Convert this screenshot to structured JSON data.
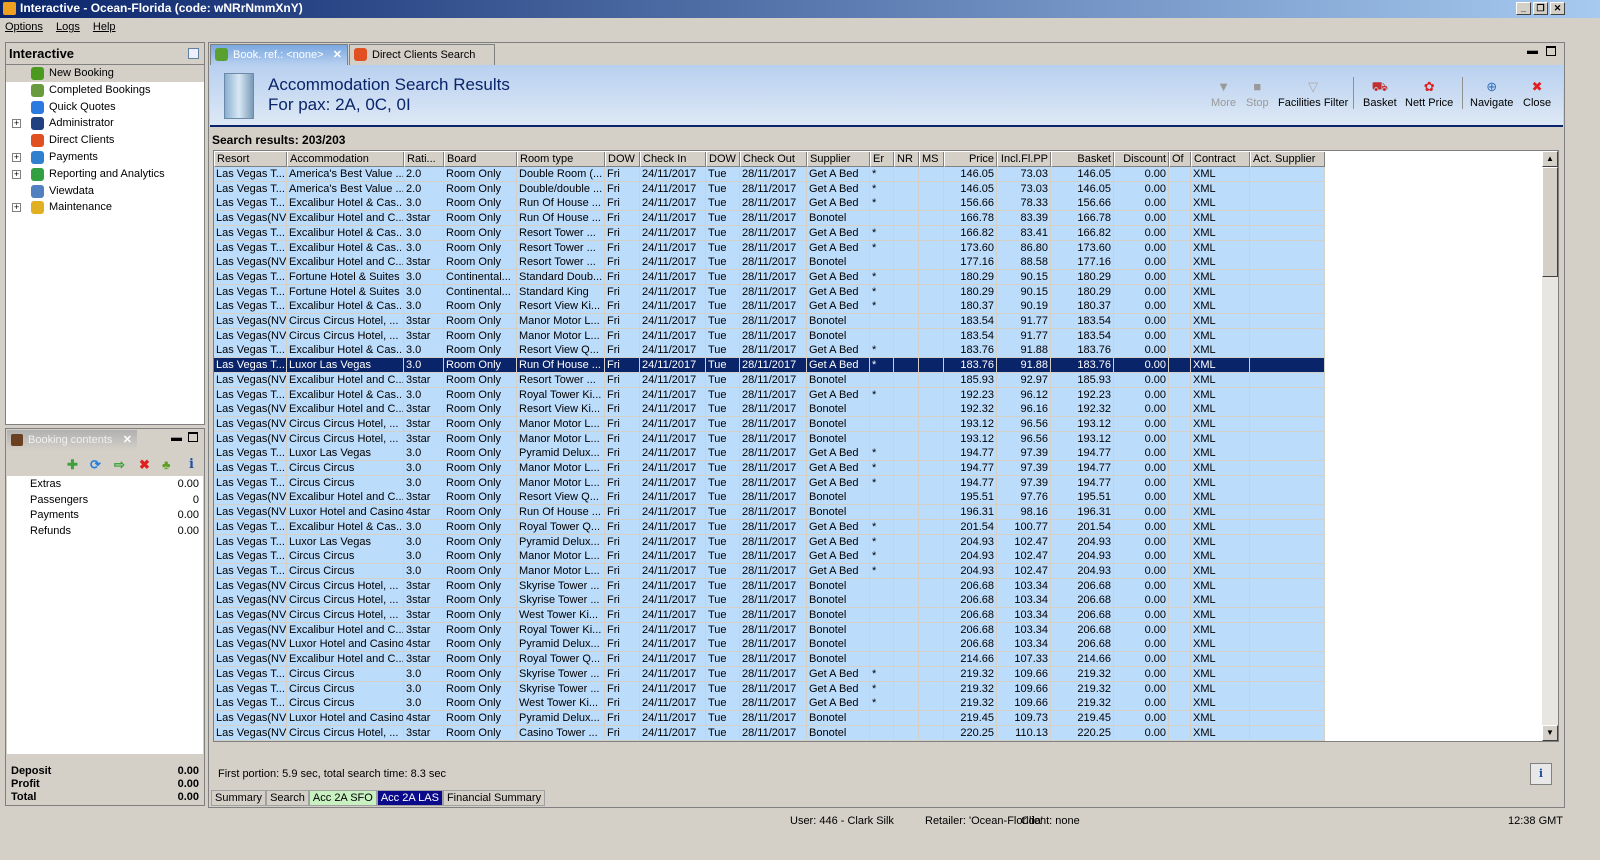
{
  "window": {
    "title": "Interactive - Ocean-Florida (code: wNRrNmmXnY)",
    "min": "_",
    "max": "❐",
    "close": "✕"
  },
  "menu": [
    "Options",
    "Logs",
    "Help"
  ],
  "nav": {
    "title": "Interactive",
    "items": [
      {
        "label": "New Booking",
        "expand": false,
        "color": "#4a9a20"
      },
      {
        "label": "Completed Bookings",
        "expand": false,
        "color": "#6a9a40"
      },
      {
        "label": "Quick Quotes",
        "expand": false,
        "color": "#2a7ae0"
      },
      {
        "label": "Administrator",
        "expand": true,
        "color": "#204080"
      },
      {
        "label": "Direct Clients",
        "expand": false,
        "color": "#e05020"
      },
      {
        "label": "Payments",
        "expand": true,
        "color": "#3080d0"
      },
      {
        "label": "Reporting and Analytics",
        "expand": true,
        "color": "#30a040"
      },
      {
        "label": "Viewdata",
        "expand": false,
        "color": "#5080c0"
      },
      {
        "label": "Maintenance",
        "expand": true,
        "color": "#e0b020"
      }
    ]
  },
  "booking": {
    "tab": "Booking contents",
    "close": "✕",
    "tools": {
      "add": "✚",
      "refresh": "⟳",
      "basket": "⇨",
      "delete": "✖",
      "palm": "♣",
      "info": "i"
    },
    "rows": [
      {
        "label": "Extras",
        "value": "0.00"
      },
      {
        "label": "Passengers",
        "value": "0"
      },
      {
        "label": "Payments",
        "value": "0.00"
      },
      {
        "label": "Refunds",
        "value": "0.00"
      }
    ],
    "totals": [
      {
        "label": "Deposit",
        "value": "0.00"
      },
      {
        "label": "Profit",
        "value": "0.00"
      },
      {
        "label": "Total",
        "value": "0.00"
      }
    ]
  },
  "tabs": [
    {
      "label": "Book. ref.: <none>",
      "close": "✕"
    },
    {
      "label": "Direct Clients Search"
    }
  ],
  "header": {
    "title": "Accommodation Search Results",
    "subtitle": "For pax: 2A, 0C, 0I"
  },
  "toolbar": {
    "more": "More",
    "stop": "Stop",
    "facilities": "Facilities Filter",
    "basket": "Basket",
    "nett": "Nett Price",
    "navigate": "Navigate",
    "close": "Close"
  },
  "results_label": "Search results: 203/203",
  "columns": [
    "Resort",
    "Accommodation",
    "Rati...",
    "Board",
    "Room type",
    "DOW",
    "Check In",
    "DOW",
    "Check Out",
    "Supplier",
    "Er",
    "NR",
    "MS",
    "Price",
    "Incl.Fl.PP",
    "Basket",
    "Discount",
    "Of",
    "Contract",
    "Act. Supplier"
  ],
  "defaults": {
    "dow_in": "Fri",
    "check_in": "24/11/2017",
    "dow_out": "Tue",
    "check_out": "28/11/2017",
    "discount": "0.00",
    "contract": "XML"
  },
  "selected_row": 13,
  "rows": [
    [
      "Las Vegas T...",
      "America's Best Value ...",
      "2.0",
      "Room Only",
      "Double Room (...",
      "Get A Bed",
      "*",
      "146.05",
      "73.03",
      "146.05"
    ],
    [
      "Las Vegas T...",
      "America's Best Value ...",
      "2.0",
      "Room Only",
      "Double/double ...",
      "Get A Bed",
      "*",
      "146.05",
      "73.03",
      "146.05"
    ],
    [
      "Las Vegas T...",
      "Excalibur Hotel & Cas...",
      "3.0",
      "Room Only",
      "Run Of House ...",
      "Get A Bed",
      "*",
      "156.66",
      "78.33",
      "156.66"
    ],
    [
      "Las Vegas(NV)",
      "Excalibur Hotel and C...",
      "3star",
      "Room Only",
      "Run Of House ...",
      "Bonotel",
      "",
      "166.78",
      "83.39",
      "166.78"
    ],
    [
      "Las Vegas T...",
      "Excalibur Hotel & Cas...",
      "3.0",
      "Room Only",
      "Resort Tower ...",
      "Get A Bed",
      "*",
      "166.82",
      "83.41",
      "166.82"
    ],
    [
      "Las Vegas T...",
      "Excalibur Hotel & Cas...",
      "3.0",
      "Room Only",
      "Resort Tower ...",
      "Get A Bed",
      "*",
      "173.60",
      "86.80",
      "173.60"
    ],
    [
      "Las Vegas(NV)",
      "Excalibur Hotel and C...",
      "3star",
      "Room Only",
      "Resort Tower ...",
      "Bonotel",
      "",
      "177.16",
      "88.58",
      "177.16"
    ],
    [
      "Las Vegas T...",
      "Fortune Hotel & Suites",
      "3.0",
      "Continental...",
      "Standard Doub...",
      "Get A Bed",
      "*",
      "180.29",
      "90.15",
      "180.29"
    ],
    [
      "Las Vegas T...",
      "Fortune Hotel & Suites",
      "3.0",
      "Continental...",
      "Standard King",
      "Get A Bed",
      "*",
      "180.29",
      "90.15",
      "180.29"
    ],
    [
      "Las Vegas T...",
      "Excalibur Hotel & Cas...",
      "3.0",
      "Room Only",
      "Resort View Ki...",
      "Get A Bed",
      "*",
      "180.37",
      "90.19",
      "180.37"
    ],
    [
      "Las Vegas(NV)",
      "Circus Circus Hotel, ...",
      "3star",
      "Room Only",
      "Manor Motor L...",
      "Bonotel",
      "",
      "183.54",
      "91.77",
      "183.54"
    ],
    [
      "Las Vegas(NV)",
      "Circus Circus Hotel, ...",
      "3star",
      "Room Only",
      "Manor Motor L...",
      "Bonotel",
      "",
      "183.54",
      "91.77",
      "183.54"
    ],
    [
      "Las Vegas T...",
      "Excalibur Hotel & Cas...",
      "3.0",
      "Room Only",
      "Resort View Q...",
      "Get A Bed",
      "*",
      "183.76",
      "91.88",
      "183.76"
    ],
    [
      "Las Vegas T...",
      "Luxor Las Vegas",
      "3.0",
      "Room Only",
      "Run Of House ...",
      "Get A Bed",
      "*",
      "183.76",
      "91.88",
      "183.76"
    ],
    [
      "Las Vegas(NV)",
      "Excalibur Hotel and C...",
      "3star",
      "Room Only",
      "Resort Tower ...",
      "Bonotel",
      "",
      "185.93",
      "92.97",
      "185.93"
    ],
    [
      "Las Vegas T...",
      "Excalibur Hotel & Cas...",
      "3.0",
      "Room Only",
      "Royal Tower Ki...",
      "Get A Bed",
      "*",
      "192.23",
      "96.12",
      "192.23"
    ],
    [
      "Las Vegas(NV)",
      "Excalibur Hotel and C...",
      "3star",
      "Room Only",
      "Resort View Ki...",
      "Bonotel",
      "",
      "192.32",
      "96.16",
      "192.32"
    ],
    [
      "Las Vegas(NV)",
      "Circus Circus Hotel, ...",
      "3star",
      "Room Only",
      "Manor Motor L...",
      "Bonotel",
      "",
      "193.12",
      "96.56",
      "193.12"
    ],
    [
      "Las Vegas(NV)",
      "Circus Circus Hotel, ...",
      "3star",
      "Room Only",
      "Manor Motor L...",
      "Bonotel",
      "",
      "193.12",
      "96.56",
      "193.12"
    ],
    [
      "Las Vegas T...",
      "Luxor Las Vegas",
      "3.0",
      "Room Only",
      "Pyramid Delux...",
      "Get A Bed",
      "*",
      "194.77",
      "97.39",
      "194.77"
    ],
    [
      "Las Vegas T...",
      "Circus Circus",
      "3.0",
      "Room Only",
      "Manor Motor L...",
      "Get A Bed",
      "*",
      "194.77",
      "97.39",
      "194.77"
    ],
    [
      "Las Vegas T...",
      "Circus Circus",
      "3.0",
      "Room Only",
      "Manor Motor L...",
      "Get A Bed",
      "*",
      "194.77",
      "97.39",
      "194.77"
    ],
    [
      "Las Vegas(NV)",
      "Excalibur Hotel and C...",
      "3star",
      "Room Only",
      "Resort View Q...",
      "Bonotel",
      "",
      "195.51",
      "97.76",
      "195.51"
    ],
    [
      "Las Vegas(NV)",
      "Luxor Hotel and Casino",
      "4star",
      "Room Only",
      "Run Of House ...",
      "Bonotel",
      "",
      "196.31",
      "98.16",
      "196.31"
    ],
    [
      "Las Vegas T...",
      "Excalibur Hotel & Cas...",
      "3.0",
      "Room Only",
      "Royal Tower Q...",
      "Get A Bed",
      "*",
      "201.54",
      "100.77",
      "201.54"
    ],
    [
      "Las Vegas T...",
      "Luxor Las Vegas",
      "3.0",
      "Room Only",
      "Pyramid Delux...",
      "Get A Bed",
      "*",
      "204.93",
      "102.47",
      "204.93"
    ],
    [
      "Las Vegas T...",
      "Circus Circus",
      "3.0",
      "Room Only",
      "Manor Motor L...",
      "Get A Bed",
      "*",
      "204.93",
      "102.47",
      "204.93"
    ],
    [
      "Las Vegas T...",
      "Circus Circus",
      "3.0",
      "Room Only",
      "Manor Motor L...",
      "Get A Bed",
      "*",
      "204.93",
      "102.47",
      "204.93"
    ],
    [
      "Las Vegas(NV)",
      "Circus Circus Hotel, ...",
      "3star",
      "Room Only",
      "Skyrise Tower ...",
      "Bonotel",
      "",
      "206.68",
      "103.34",
      "206.68"
    ],
    [
      "Las Vegas(NV)",
      "Circus Circus Hotel, ...",
      "3star",
      "Room Only",
      "Skyrise Tower ...",
      "Bonotel",
      "",
      "206.68",
      "103.34",
      "206.68"
    ],
    [
      "Las Vegas(NV)",
      "Circus Circus Hotel, ...",
      "3star",
      "Room Only",
      "West Tower Ki...",
      "Bonotel",
      "",
      "206.68",
      "103.34",
      "206.68"
    ],
    [
      "Las Vegas(NV)",
      "Excalibur Hotel and C...",
      "3star",
      "Room Only",
      "Royal Tower Ki...",
      "Bonotel",
      "",
      "206.68",
      "103.34",
      "206.68"
    ],
    [
      "Las Vegas(NV)",
      "Luxor Hotel and Casino",
      "4star",
      "Room Only",
      "Pyramid Delux...",
      "Bonotel",
      "",
      "206.68",
      "103.34",
      "206.68"
    ],
    [
      "Las Vegas(NV)",
      "Excalibur Hotel and C...",
      "3star",
      "Room Only",
      "Royal Tower Q...",
      "Bonotel",
      "",
      "214.66",
      "107.33",
      "214.66"
    ],
    [
      "Las Vegas T...",
      "Circus Circus",
      "3.0",
      "Room Only",
      "Skyrise Tower ...",
      "Get A Bed",
      "*",
      "219.32",
      "109.66",
      "219.32"
    ],
    [
      "Las Vegas T...",
      "Circus Circus",
      "3.0",
      "Room Only",
      "Skyrise Tower ...",
      "Get A Bed",
      "*",
      "219.32",
      "109.66",
      "219.32"
    ],
    [
      "Las Vegas T...",
      "Circus Circus",
      "3.0",
      "Room Only",
      "West Tower Ki...",
      "Get A Bed",
      "*",
      "219.32",
      "109.66",
      "219.32"
    ],
    [
      "Las Vegas(NV)",
      "Luxor Hotel and Casino",
      "4star",
      "Room Only",
      "Pyramid Delux...",
      "Bonotel",
      "",
      "219.45",
      "109.73",
      "219.45"
    ],
    [
      "Las Vegas(NV)",
      "Circus Circus Hotel, ...",
      "3star",
      "Room Only",
      "Casino Tower ...",
      "Bonotel",
      "",
      "220.25",
      "110.13",
      "220.25"
    ]
  ],
  "footer": "First portion: 5.9 sec, total search time: 8.3 sec",
  "info_button": "i",
  "bottom_tabs": [
    {
      "label": "Summary"
    },
    {
      "label": "Search"
    },
    {
      "label": "Acc 2A SFO",
      "color": "#c8f0c0"
    },
    {
      "label": "Acc 2A LAS",
      "color": "#0a0a8a",
      "selected": true
    },
    {
      "label": "Financial Summary"
    }
  ],
  "status": {
    "user": "User: 446 - Clark Silk",
    "retailer": "Retailer: 'Ocean-Florida'",
    "client": "Client: none",
    "time": "12:38 GMT"
  }
}
